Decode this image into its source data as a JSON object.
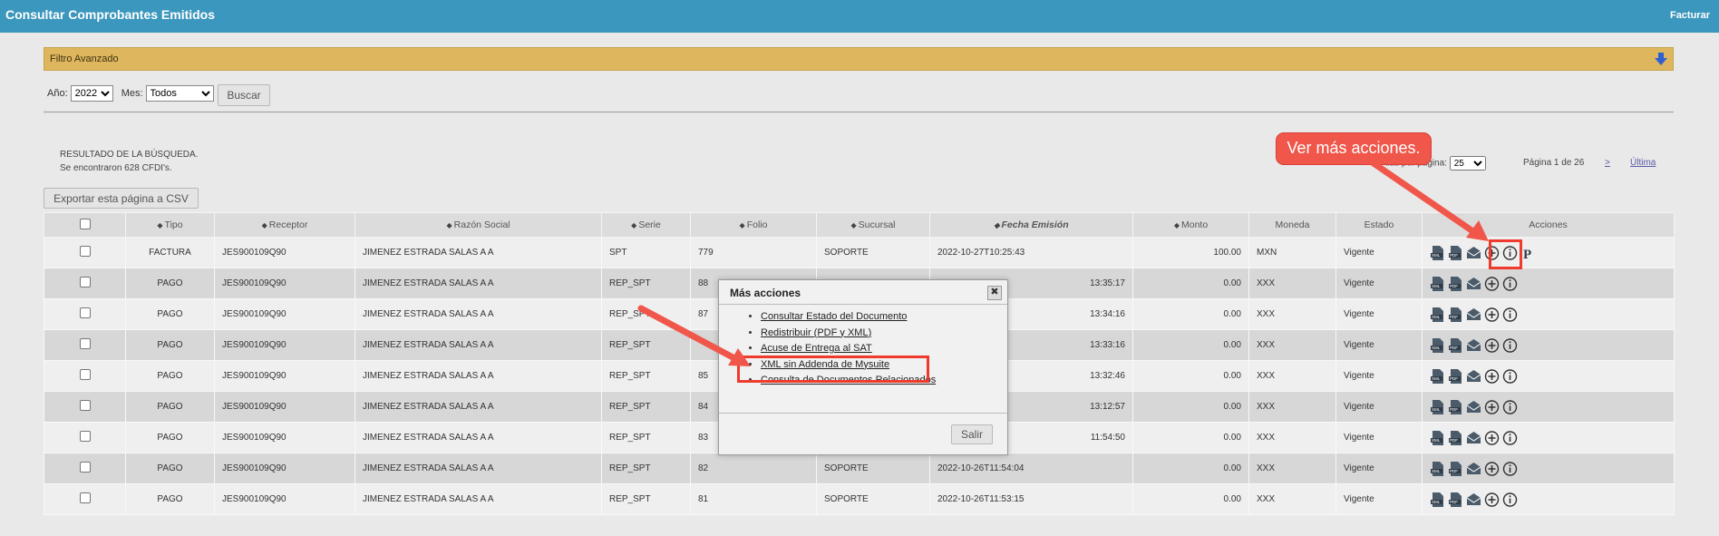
{
  "header": {
    "title": "Consultar Comprobantes Emitidos",
    "right_link": "Facturar"
  },
  "filter": {
    "bar_label": "Filtro Avanzado",
    "year_label": "Año:",
    "year_value": "2022",
    "month_label": "Mes:",
    "month_value": "Todos",
    "search_button": "Buscar"
  },
  "results": {
    "line1": "RESULTADO DE LA BÚSQUEDA.",
    "line2": "Se encontraron 628 CFDI's.",
    "export_button": "Exportar esta página a CSV"
  },
  "pagination": {
    "per_page_label": "Filas por página:",
    "per_page_value": "25",
    "page_info": "Página 1 de 26",
    "next": ">",
    "last": "Última"
  },
  "table": {
    "columns": [
      "Tipo",
      "Receptor",
      "Razón Social",
      "Serie",
      "Folio",
      "Sucursal",
      "Fecha Emisión",
      "Monto",
      "Moneda",
      "Estado",
      "Acciones"
    ],
    "rows": [
      {
        "tipo": "FACTURA",
        "receptor": "JES900109Q90",
        "razon": "JIMENEZ ESTRADA SALAS A A",
        "serie": "SPT",
        "folio": "779",
        "sucursal": "SOPORTE",
        "fecha": "2022-10-27T10:25:43",
        "monto": "100.00",
        "moneda": "MXN",
        "estado": "Vigente"
      },
      {
        "tipo": "PAGO",
        "receptor": "JES900109Q90",
        "razon": "JIMENEZ ESTRADA SALAS A A",
        "serie": "REP_SPT",
        "folio": "88",
        "sucursal": "",
        "fecha": "13:35:17",
        "monto": "0.00",
        "moneda": "XXX",
        "estado": "Vigente"
      },
      {
        "tipo": "PAGO",
        "receptor": "JES900109Q90",
        "razon": "JIMENEZ ESTRADA SALAS A A",
        "serie": "REP_SPT",
        "folio": "87",
        "sucursal": "",
        "fecha": "13:34:16",
        "monto": "0.00",
        "moneda": "XXX",
        "estado": "Vigente"
      },
      {
        "tipo": "PAGO",
        "receptor": "JES900109Q90",
        "razon": "JIMENEZ ESTRADA SALAS A A",
        "serie": "REP_SPT",
        "folio": "",
        "sucursal": "",
        "fecha": "13:33:16",
        "monto": "0.00",
        "moneda": "XXX",
        "estado": "Vigente"
      },
      {
        "tipo": "PAGO",
        "receptor": "JES900109Q90",
        "razon": "JIMENEZ ESTRADA SALAS A A",
        "serie": "REP_SPT",
        "folio": "85",
        "sucursal": "",
        "fecha": "13:32:46",
        "monto": "0.00",
        "moneda": "XXX",
        "estado": "Vigente"
      },
      {
        "tipo": "PAGO",
        "receptor": "JES900109Q90",
        "razon": "JIMENEZ ESTRADA SALAS A A",
        "serie": "REP_SPT",
        "folio": "84",
        "sucursal": "",
        "fecha": "13:12:57",
        "monto": "0.00",
        "moneda": "XXX",
        "estado": "Vigente"
      },
      {
        "tipo": "PAGO",
        "receptor": "JES900109Q90",
        "razon": "JIMENEZ ESTRADA SALAS A A",
        "serie": "REP_SPT",
        "folio": "83",
        "sucursal": "",
        "fecha": "11:54:50",
        "monto": "0.00",
        "moneda": "XXX",
        "estado": "Vigente"
      },
      {
        "tipo": "PAGO",
        "receptor": "JES900109Q90",
        "razon": "JIMENEZ ESTRADA SALAS A A",
        "serie": "REP_SPT",
        "folio": "82",
        "sucursal": "SOPORTE",
        "fecha": "2022-10-26T11:54:04",
        "monto": "0.00",
        "moneda": "XXX",
        "estado": "Vigente"
      },
      {
        "tipo": "PAGO",
        "receptor": "JES900109Q90",
        "razon": "JIMENEZ ESTRADA SALAS A A",
        "serie": "REP_SPT",
        "folio": "81",
        "sucursal": "SOPORTE",
        "fecha": "2022-10-26T11:53:15",
        "monto": "0.00",
        "moneda": "XXX",
        "estado": "Vigente"
      }
    ]
  },
  "modal": {
    "title": "Más acciones",
    "close": "✖",
    "items": [
      "Consultar Estado del Documento",
      "Redistribuir (PDF y XML)",
      "Acuse de Entrega al SAT",
      "XML sin Addenda de Mysuite",
      "Consulta de Documentos Relacionados"
    ],
    "exit_button": "Salir"
  },
  "annotation": {
    "callout_text": "Ver más acciones.",
    "accent": "#f0564a"
  }
}
